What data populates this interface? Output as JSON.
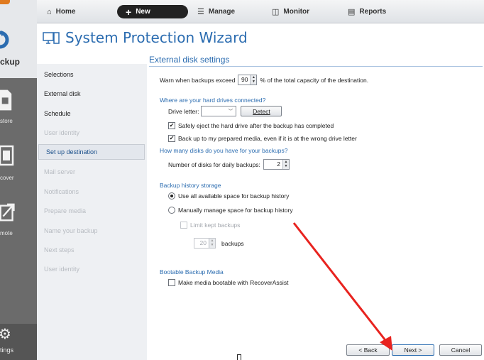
{
  "sidebar": {
    "backup_label": "ckup",
    "restore_label": "store",
    "recover_label": "cover",
    "remote_label": "mote",
    "settings_label": "tings"
  },
  "toolbar": {
    "home": "Home",
    "new": "New",
    "manage": "Manage",
    "monitor": "Monitor",
    "reports": "Reports"
  },
  "wizard": {
    "title": "System Protection Wizard"
  },
  "steps": [
    {
      "label": "Selections",
      "state": "normal"
    },
    {
      "label": "External disk",
      "state": "normal"
    },
    {
      "label": "Schedule",
      "state": "normal"
    },
    {
      "label": "User identity",
      "state": "dim"
    },
    {
      "label": "Set up destination",
      "state": "active"
    },
    {
      "label": "Mail server",
      "state": "dim"
    },
    {
      "label": "Notifications",
      "state": "dim"
    },
    {
      "label": "Prepare media",
      "state": "dim"
    },
    {
      "label": "Name your backup",
      "state": "dim"
    },
    {
      "label": "Next steps",
      "state": "dim"
    },
    {
      "label": "User identity",
      "state": "dim"
    }
  ],
  "main": {
    "section_title": "External disk settings",
    "warn_prefix": "Warn when backups exceed",
    "warn_value": "90",
    "warn_suffix": "% of the total capacity of the destination.",
    "where_heading": "Where are your hard drives connected?",
    "drive_letter_label": "Drive letter:",
    "detect_button": "Detect",
    "safely_eject_label": "Safely eject the hard drive after the backup has completed",
    "safely_eject_checked": true,
    "backup_prepared_label": "Back up to my prepared media, even if it is at the wrong drive letter",
    "backup_prepared_checked": true,
    "how_many_heading": "How many disks do you have for your backups?",
    "num_disks_label": "Number of disks for daily backups:",
    "num_disks_value": "2",
    "history_heading": "Backup history storage",
    "use_all_label": "Use all available space for backup history",
    "manual_label": "Manually manage space for backup history",
    "limit_label": "Limit kept backups",
    "limit_value": "20",
    "limit_suffix": "backups",
    "bootable_heading": "Bootable Backup Media",
    "bootable_label": "Make media bootable with RecoverAssist",
    "bootable_checked": false
  },
  "buttons": {
    "back": "< Back",
    "next": "Next >",
    "cancel": "Cancel"
  },
  "colors": {
    "accent": "#2b6cb0",
    "arrow": "#e8231f",
    "sidebar": "#6b6b6b"
  }
}
